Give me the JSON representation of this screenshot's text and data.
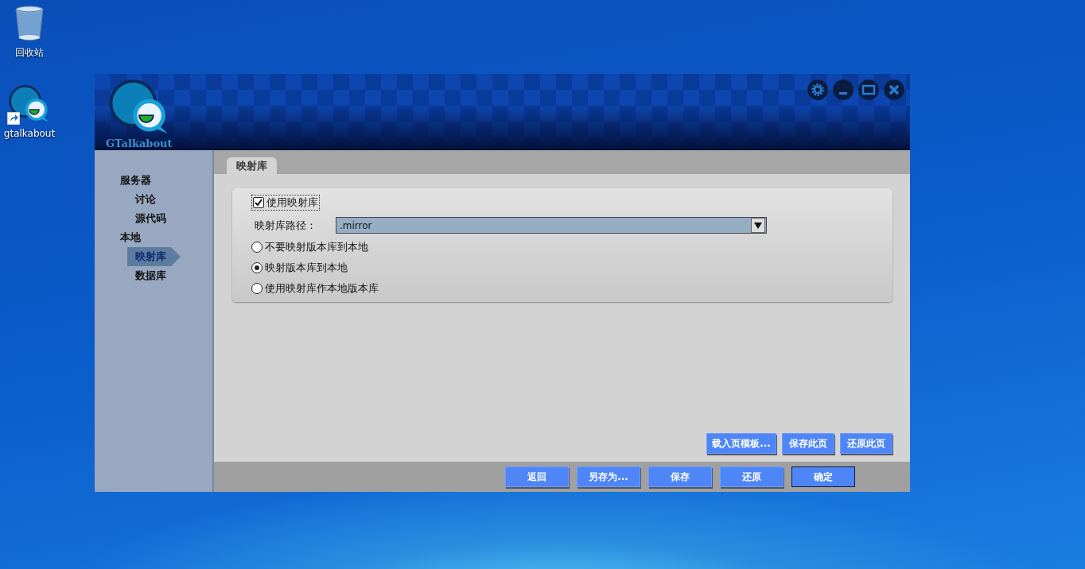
{
  "desktop_icons": [
    {
      "label": "回收站",
      "kind": "recycle-bin"
    },
    {
      "label": "gtalkabout",
      "kind": "shortcut"
    }
  ],
  "window": {
    "logo_text": "GTalkabout"
  },
  "sidebar": {
    "items": [
      {
        "label": "服务器",
        "selected": false,
        "children": [
          {
            "label": "讨论",
            "selected": false
          },
          {
            "label": "源代码",
            "selected": false
          }
        ]
      },
      {
        "label": "本地",
        "selected": false,
        "children": [
          {
            "label": "映射库",
            "selected": true
          },
          {
            "label": "数据库",
            "selected": false
          }
        ]
      }
    ]
  },
  "tabs": [
    {
      "label": "映射库",
      "selected": true
    }
  ],
  "mirror_settings": {
    "use_mirror": {
      "label": "使用映射库",
      "checked": true
    },
    "path": {
      "label": "映射库路径：",
      "value": ".mirror"
    },
    "radios": [
      {
        "label": "不要映射版本库到本地",
        "selected": false
      },
      {
        "label": "映射版本库到本地",
        "selected": true
      },
      {
        "label": "使用映射库作本地版本库",
        "selected": false
      }
    ]
  },
  "page_buttons": [
    "载入页模板...",
    "保存此页",
    "还原此页"
  ],
  "footer_buttons": [
    {
      "label": "返回",
      "default": false
    },
    {
      "label": "另存为...",
      "default": false
    },
    {
      "label": "保存",
      "default": false
    },
    {
      "label": "还原",
      "default": false
    },
    {
      "label": "确定",
      "default": true
    }
  ]
}
